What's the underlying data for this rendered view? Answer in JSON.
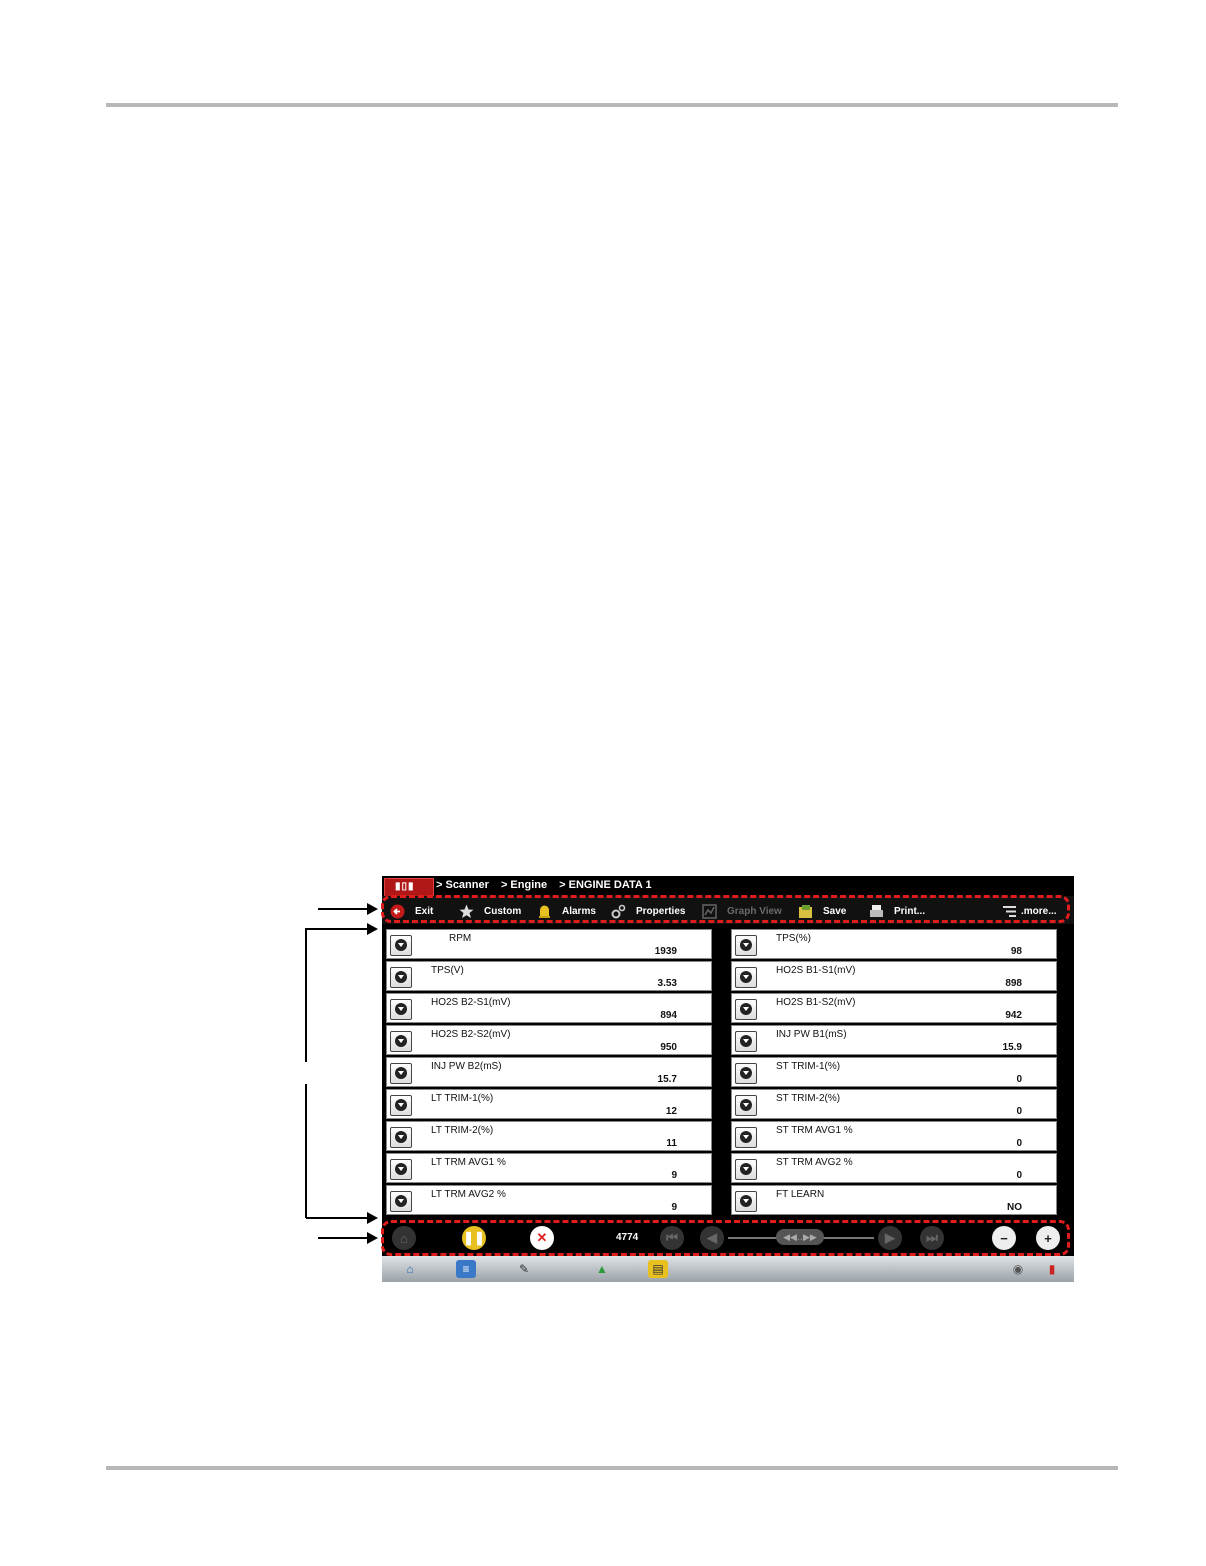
{
  "breadcrumb": [
    "> Scanner",
    "> Engine",
    "> ENGINE DATA 1"
  ],
  "toolbar": [
    {
      "label": "Exit",
      "icon": "exit-icon",
      "enabled": true
    },
    {
      "label": "Custom",
      "icon": "star-icon",
      "enabled": true
    },
    {
      "label": "Alarms",
      "icon": "bell-icon",
      "enabled": true
    },
    {
      "label": "Properties",
      "icon": "gears-icon",
      "enabled": true
    },
    {
      "label": "Graph View",
      "icon": "graph-icon",
      "enabled": false
    },
    {
      "label": "Save",
      "icon": "save-icon",
      "enabled": true
    },
    {
      "label": "Print...",
      "icon": "printer-icon",
      "enabled": true
    },
    {
      "label": ".more...",
      "icon": "more-icon",
      "enabled": true
    }
  ],
  "pids": {
    "left": [
      {
        "name": "RPM",
        "value": "1939"
      },
      {
        "name": "TPS(V)",
        "value": "3.53"
      },
      {
        "name": "HO2S B2-S1(mV)",
        "value": "894"
      },
      {
        "name": "HO2S B2-S2(mV)",
        "value": "950"
      },
      {
        "name": "INJ PW B2(mS)",
        "value": "15.7"
      },
      {
        "name": "LT TRIM-1(%)",
        "value": "12"
      },
      {
        "name": "LT TRIM-2(%)",
        "value": "11"
      },
      {
        "name": "LT TRM AVG1 %",
        "value": "9"
      },
      {
        "name": "LT TRM AVG2 %",
        "value": "9"
      }
    ],
    "right": [
      {
        "name": "TPS(%)",
        "value": "98"
      },
      {
        "name": "HO2S B1-S1(mV)",
        "value": "898"
      },
      {
        "name": "HO2S B1-S2(mV)",
        "value": "942"
      },
      {
        "name": "INJ PW B1(mS)",
        "value": "15.9"
      },
      {
        "name": "ST TRIM-1(%)",
        "value": "0"
      },
      {
        "name": "ST TRIM-2(%)",
        "value": "0"
      },
      {
        "name": "ST TRM AVG1 %",
        "value": "0"
      },
      {
        "name": "ST TRM AVG2 %",
        "value": "0"
      },
      {
        "name": "FT LEARN",
        "value": "NO"
      }
    ]
  },
  "controls": {
    "frame_counter": "4774"
  },
  "colors": {
    "highlight_dash": "#e01c1c",
    "screen_bg": "#000000",
    "rule": "#b8b8b8"
  }
}
